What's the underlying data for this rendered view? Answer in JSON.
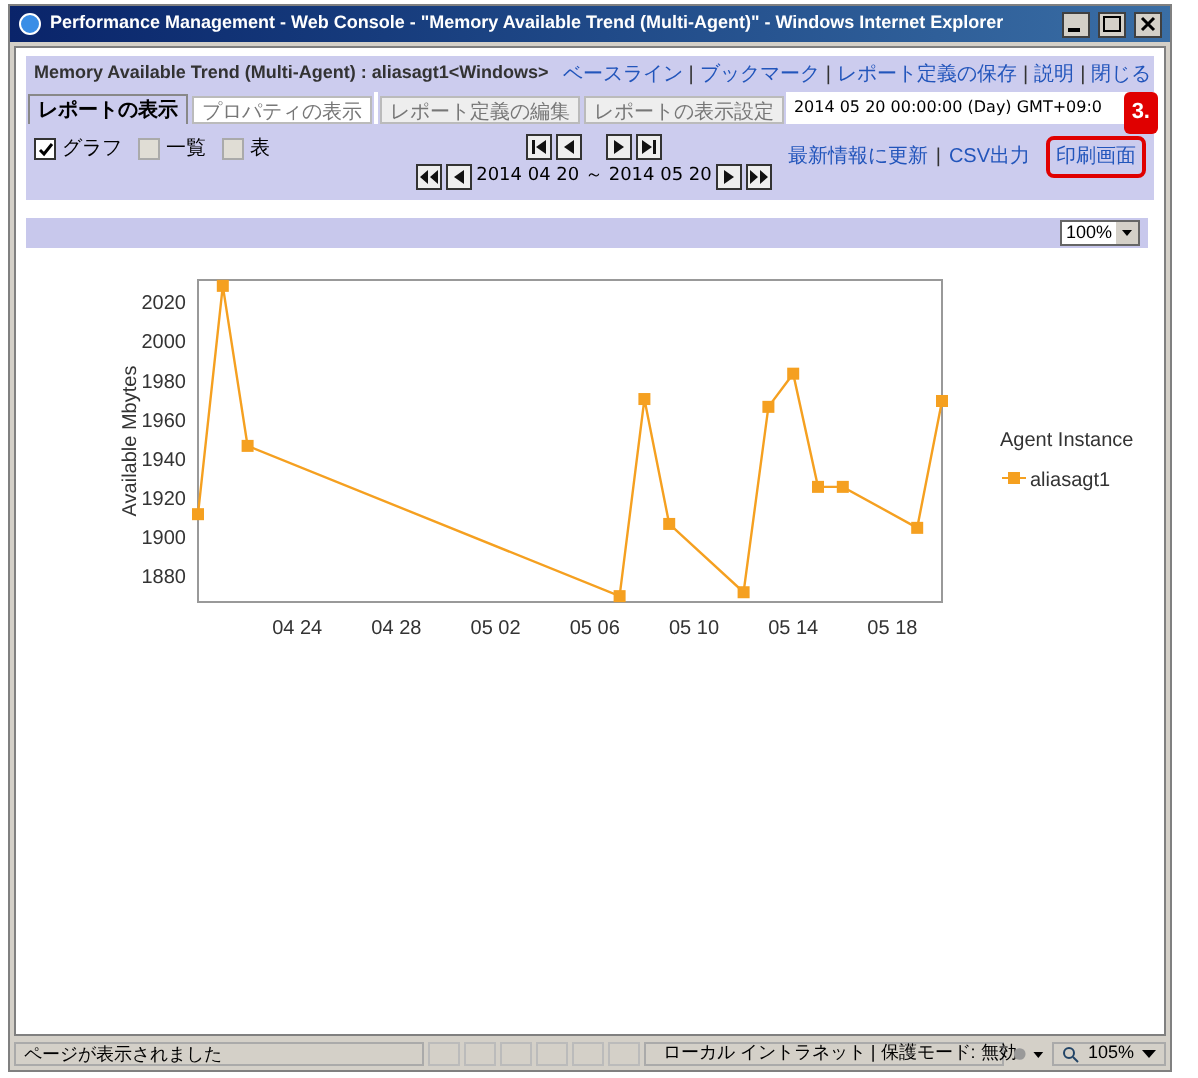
{
  "window": {
    "title": "Performance Management - Web Console - \"Memory Available Trend (Multi-Agent)\" - Windows Internet Explorer"
  },
  "header": {
    "report_title": "Memory Available Trend (Multi-Agent) : aliasagt1<Windows>",
    "links": [
      "ベースライン",
      "ブックマーク",
      "レポート定義の保存",
      "説明",
      "閉じる"
    ],
    "separator": "|"
  },
  "tabs": [
    {
      "label": "レポートの表示",
      "selected": true
    },
    {
      "label": "プロパティの表示",
      "selected": false
    }
  ],
  "right_tabs": [
    {
      "label": "レポート定義の編集",
      "selected": false
    },
    {
      "label": "レポートの表示設定",
      "selected": false
    }
  ],
  "report_time": "2014 05 20 00:00:00 (Day) GMT+09:0",
  "view_options": [
    {
      "label": "グラフ",
      "checked": true
    },
    {
      "label": "一覧",
      "checked": false
    },
    {
      "label": "表",
      "checked": false
    }
  ],
  "date_range": "2014 04 20 ～ 2014 05 20",
  "actions": [
    "最新情報に更新",
    "CSV出力"
  ],
  "actions_separator": "|",
  "print_button": {
    "label": "印刷画面",
    "highlighted": true
  },
  "callout": {
    "label": "3."
  },
  "zoom_select": {
    "value": "100%"
  },
  "chart": {
    "chart_data": {
      "type": "line",
      "ylabel": "Available Mbytes",
      "categories": [
        null,
        null,
        null,
        null,
        "04 24",
        null,
        null,
        null,
        "04 28",
        null,
        null,
        null,
        "05 02",
        null,
        null,
        null,
        "05 06",
        null,
        null,
        null,
        "05 10",
        null,
        null,
        null,
        "05 14",
        null,
        null,
        null,
        "05 18",
        null,
        null
      ],
      "series": [
        {
          "name": "aliasagt1",
          "color": "#f5a020",
          "marker": "square",
          "values": [
            1911,
            2028,
            1946,
            null,
            null,
            null,
            null,
            null,
            null,
            null,
            null,
            null,
            null,
            null,
            null,
            null,
            null,
            1869,
            1970,
            1906,
            null,
            null,
            1871,
            1966,
            1983,
            1925,
            1925,
            null,
            null,
            1904,
            1969
          ]
        }
      ],
      "ylim": [
        1866,
        2031
      ],
      "yticks": [
        1880,
        1900,
        1920,
        1940,
        1960,
        1980,
        2000,
        2020
      ]
    },
    "legend_title": "Agent Instance"
  },
  "status_bar": {
    "message": "ページが表示されました",
    "zone": "ローカル イントラネット | 保護モード: 無効",
    "zoom": "105%"
  }
}
